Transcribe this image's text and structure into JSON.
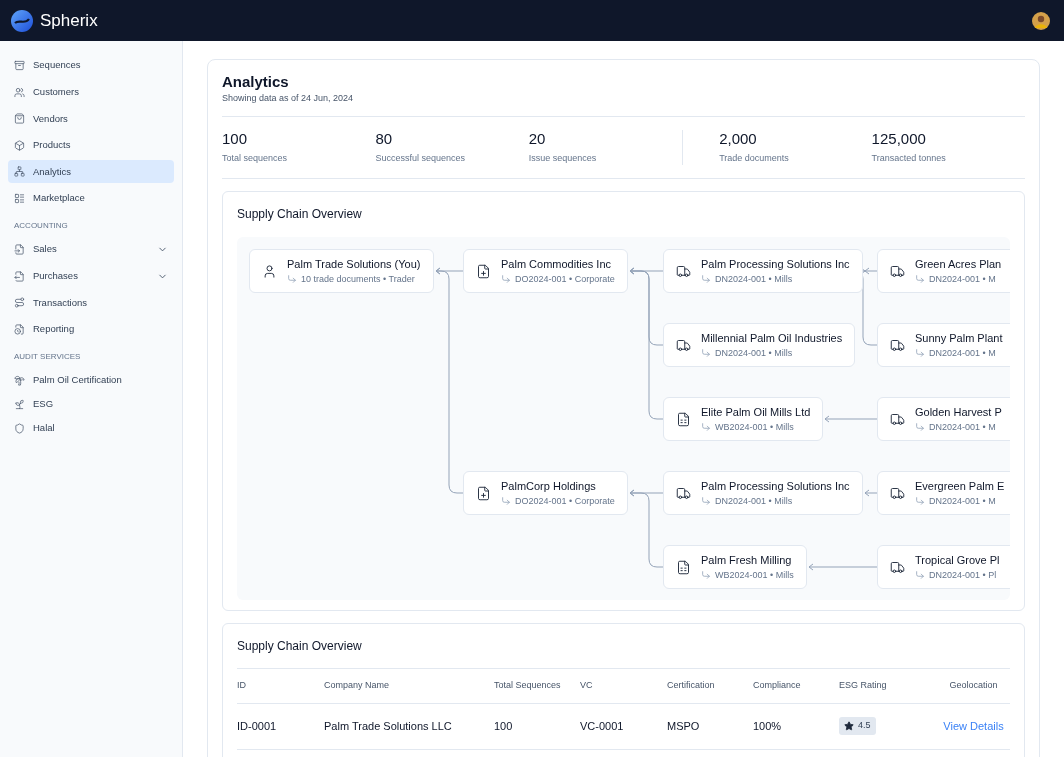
{
  "brand": "Spherix",
  "sidebar": {
    "sections": [
      {
        "items": [
          {
            "label": "Sequences",
            "selected": false
          },
          {
            "label": "Customers",
            "selected": false
          },
          {
            "label": "Vendors",
            "selected": false
          },
          {
            "label": "Products",
            "selected": false
          },
          {
            "label": "Analytics",
            "selected": true
          },
          {
            "label": "Marketplace",
            "selected": false
          }
        ]
      },
      {
        "heading": "ACCOUNTING",
        "items": [
          {
            "label": "Sales",
            "selected": false,
            "expanded": false
          },
          {
            "label": "Purchases",
            "selected": false,
            "expanded": false
          },
          {
            "label": "Transactions",
            "selected": false
          },
          {
            "label": "Reporting",
            "selected": false
          }
        ]
      },
      {
        "heading": "AUDIT SERVICES",
        "items": [
          {
            "label": "Palm Oil Certification",
            "selected": false
          },
          {
            "label": "ESG",
            "selected": false
          },
          {
            "label": "Halal",
            "selected": false
          }
        ]
      }
    ]
  },
  "page": {
    "title": "Analytics",
    "subtitle": "Showing data as of 24 Jun, 2024"
  },
  "stats": [
    {
      "value": "100",
      "label": "Total sequences"
    },
    {
      "value": "80",
      "label": "Successful sequences"
    },
    {
      "value": "20",
      "label": "Issue sequences"
    },
    {
      "value": "2,000",
      "label": "Trade documents"
    },
    {
      "value": "125,000",
      "label": "Transacted tonnes"
    }
  ],
  "diagram": {
    "title": "Supply Chain Overview",
    "root": {
      "kind": "trader",
      "name": "Palm Trade Solutions (You)",
      "detail": "10 trade documents • Trader",
      "children": [
        {
          "kind": "delivery-order",
          "name": "Palm Commodities Inc",
          "detail": "DO2024-001 • Corporate",
          "children": [
            {
              "kind": "delivery-note",
              "name": "Palm Processing Solutions Inc",
              "detail": "DN2024-001 • Mills",
              "children": [
                {
                  "kind": "delivery-note",
                  "name": "Green Acres Plan",
                  "detail": "DN2024-001 • M"
                },
                {
                  "kind": "delivery-note",
                  "name": "Sunny Palm Plant",
                  "detail": "DN2024-001 • M"
                }
              ]
            },
            {
              "kind": "delivery-note",
              "name": "Millennial Palm Oil Industries",
              "detail": "DN2024-001 • Mills"
            },
            {
              "kind": "weighbridge",
              "name": "Elite Palm Oil Mills Ltd",
              "detail": "WB2024-001 • Mills",
              "children": [
                {
                  "kind": "delivery-note",
                  "name": "Golden Harvest P",
                  "detail": "DN2024-001 • M"
                }
              ]
            }
          ]
        },
        {
          "kind": "delivery-order",
          "name": "PalmCorp Holdings",
          "detail": "DO2024-001 • Corporate",
          "children": [
            {
              "kind": "delivery-note",
              "name": "Palm Processing Solutions Inc",
              "detail": "DN2024-001 • Mills",
              "children": [
                {
                  "kind": "delivery-note",
                  "name": "Evergreen Palm E",
                  "detail": "DN2024-001 • M"
                }
              ]
            },
            {
              "kind": "weighbridge",
              "name": "Palm Fresh Milling",
              "detail": "WB2024-001 • Mills",
              "children": [
                {
                  "kind": "delivery-note",
                  "name": "Tropical Grove Pl",
                  "detail": "DN2024-001 • Pl"
                }
              ]
            }
          ]
        }
      ]
    }
  },
  "table": {
    "title": "Supply Chain Overview",
    "columns": [
      "ID",
      "Company Name",
      "Total Sequences",
      "VC",
      "Certification",
      "Compliance",
      "ESG Rating",
      "Geolocation"
    ],
    "rows": [
      {
        "id": "ID-0001",
        "company": "Palm Trade Solutions LLC",
        "total_sequences": "100",
        "vc": "VC-0001",
        "certification": "MSPO",
        "compliance": "100%",
        "esg_rating": "4.5",
        "geolocation": "View Details"
      }
    ]
  }
}
